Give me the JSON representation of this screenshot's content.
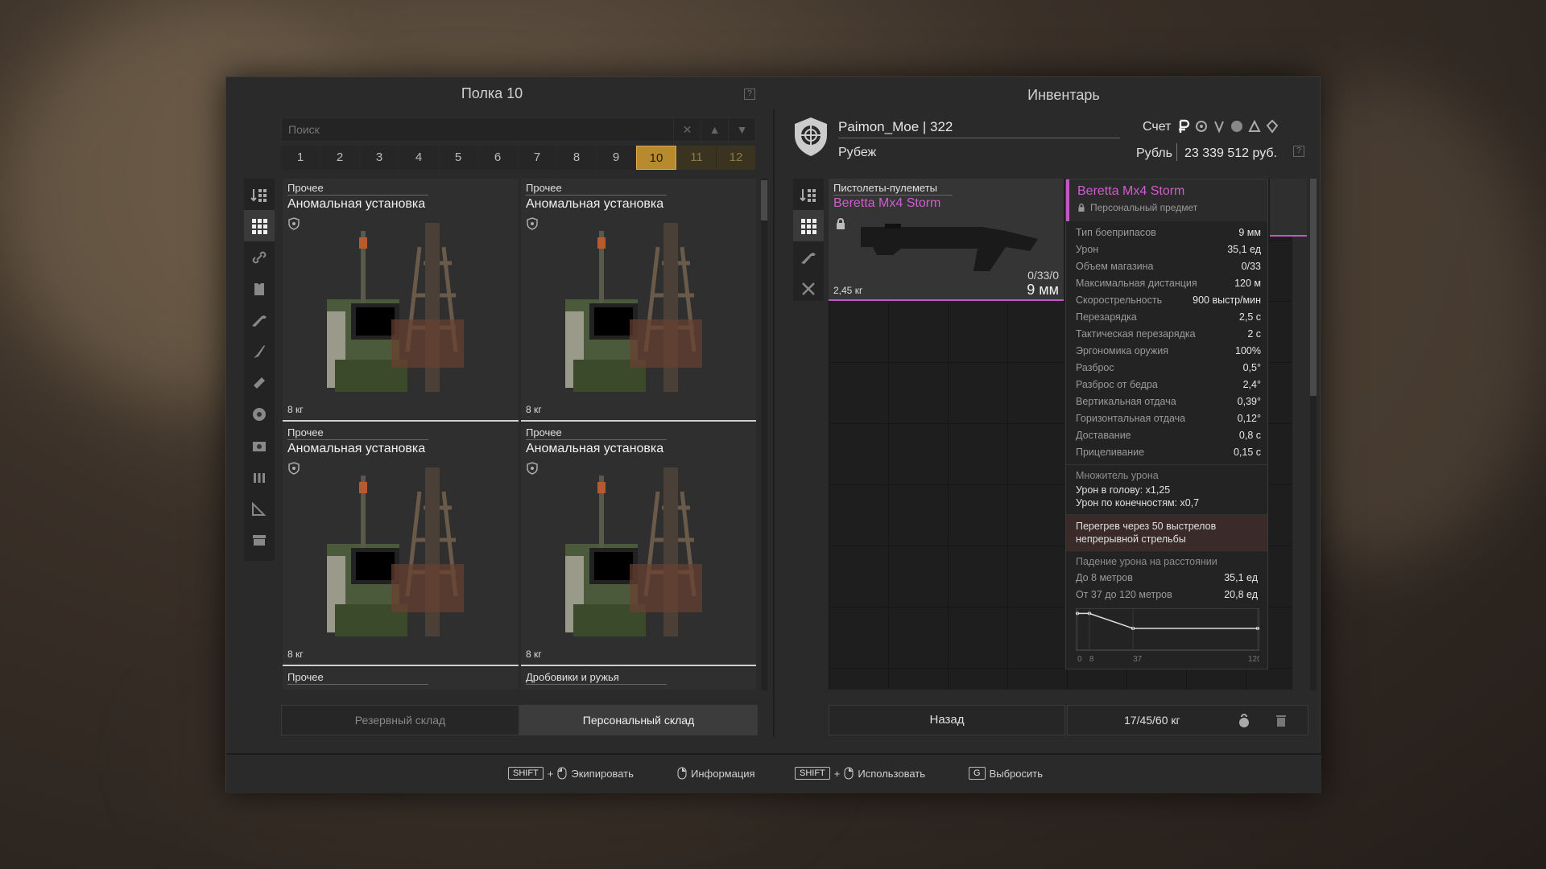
{
  "shelf": {
    "title": "Полка 10",
    "search_placeholder": "Поиск",
    "pages": [
      "1",
      "2",
      "3",
      "4",
      "5",
      "6",
      "7",
      "8",
      "9",
      "10",
      "11",
      "12"
    ],
    "active_page": "10",
    "items": [
      {
        "category": "Прочее",
        "name": "Аномальная установка",
        "weight": "8 кг"
      },
      {
        "category": "Прочее",
        "name": "Аномальная установка",
        "weight": "8 кг"
      },
      {
        "category": "Прочее",
        "name": "Аномальная установка",
        "weight": "8 кг"
      },
      {
        "category": "Прочее",
        "name": "Аномальная установка",
        "weight": "8 кг"
      },
      {
        "category": "Прочее",
        "name": ""
      },
      {
        "category": "Дробовики и ружья",
        "name": ""
      }
    ],
    "tabs": {
      "reserve": "Резервный склад",
      "personal": "Персональный склад"
    }
  },
  "inventory": {
    "title": "Инвентарь",
    "player": "Paimon_Moe | 322",
    "faction": "Рубеж",
    "account_label": "Счет",
    "balance_label": "Рубль",
    "balance_value": "23 339 512 руб.",
    "weapon": {
      "category": "Пистолеты-пулеметы",
      "name": "Beretta Mx4 Storm",
      "ammo": "0/33/0",
      "caliber": "9 мм",
      "weight": "2,45 кг"
    },
    "back_label": "Назад",
    "weight_text": "17/45/60 кг"
  },
  "tooltip": {
    "title": "Beretta Mx4 Storm",
    "subtitle": "Персональный предмет",
    "stats": [
      {
        "k": "Тип боеприпасов",
        "v": "9 мм"
      },
      {
        "k": "Урон",
        "v": "35,1 ед"
      },
      {
        "k": "Объем магазина",
        "v": "0/33"
      },
      {
        "k": "Максимальная дистанция",
        "v": "120 м"
      },
      {
        "k": "Скорострельность",
        "v": "900 выстр/мин"
      },
      {
        "k": "Перезарядка",
        "v": "2,5 с"
      },
      {
        "k": "Тактическая перезарядка",
        "v": "2 с"
      },
      {
        "k": "Эргономика оружия",
        "v": "100%"
      },
      {
        "k": "Разброс",
        "v": "0,5°"
      },
      {
        "k": "Разброс от бедра",
        "v": "2,4°"
      },
      {
        "k": "Вертикальная отдача",
        "v": "0,39°"
      },
      {
        "k": "Горизонтальная отдача",
        "v": "0,12°"
      },
      {
        "k": "Доставание",
        "v": "0,8 с"
      },
      {
        "k": "Прицеливание",
        "v": "0,15 с"
      }
    ],
    "multiplier_header": "Множитель урона",
    "multiplier_head": "Урон в голову: x1,25",
    "multiplier_limbs": "Урон по конечностям: x0,7",
    "overheat_1": "Перегрев через 50 выстрелов",
    "overheat_2": "непрерывной стрельбы",
    "falloff_header": "Падение урона на расстоянии",
    "falloff": [
      {
        "k": "До 8 метров",
        "v": "35,1 ед"
      },
      {
        "k": "От 37 до 120 метров",
        "v": "20,8 ед"
      }
    ],
    "graph_ticks": [
      "0",
      "8",
      "37",
      "120"
    ],
    "graph_points": [
      [
        0,
        35.1
      ],
      [
        8,
        35.1
      ],
      [
        37,
        20.8
      ],
      [
        120,
        20.8
      ]
    ]
  },
  "footer": {
    "shift": "SHIFT",
    "plus": "+",
    "equip": "Экипировать",
    "info": "Информация",
    "use": "Использовать",
    "drop_key": "G",
    "drop": "Выбросить"
  },
  "colors": {
    "accent": "#b88a2e",
    "personal": "#d25bd2"
  }
}
